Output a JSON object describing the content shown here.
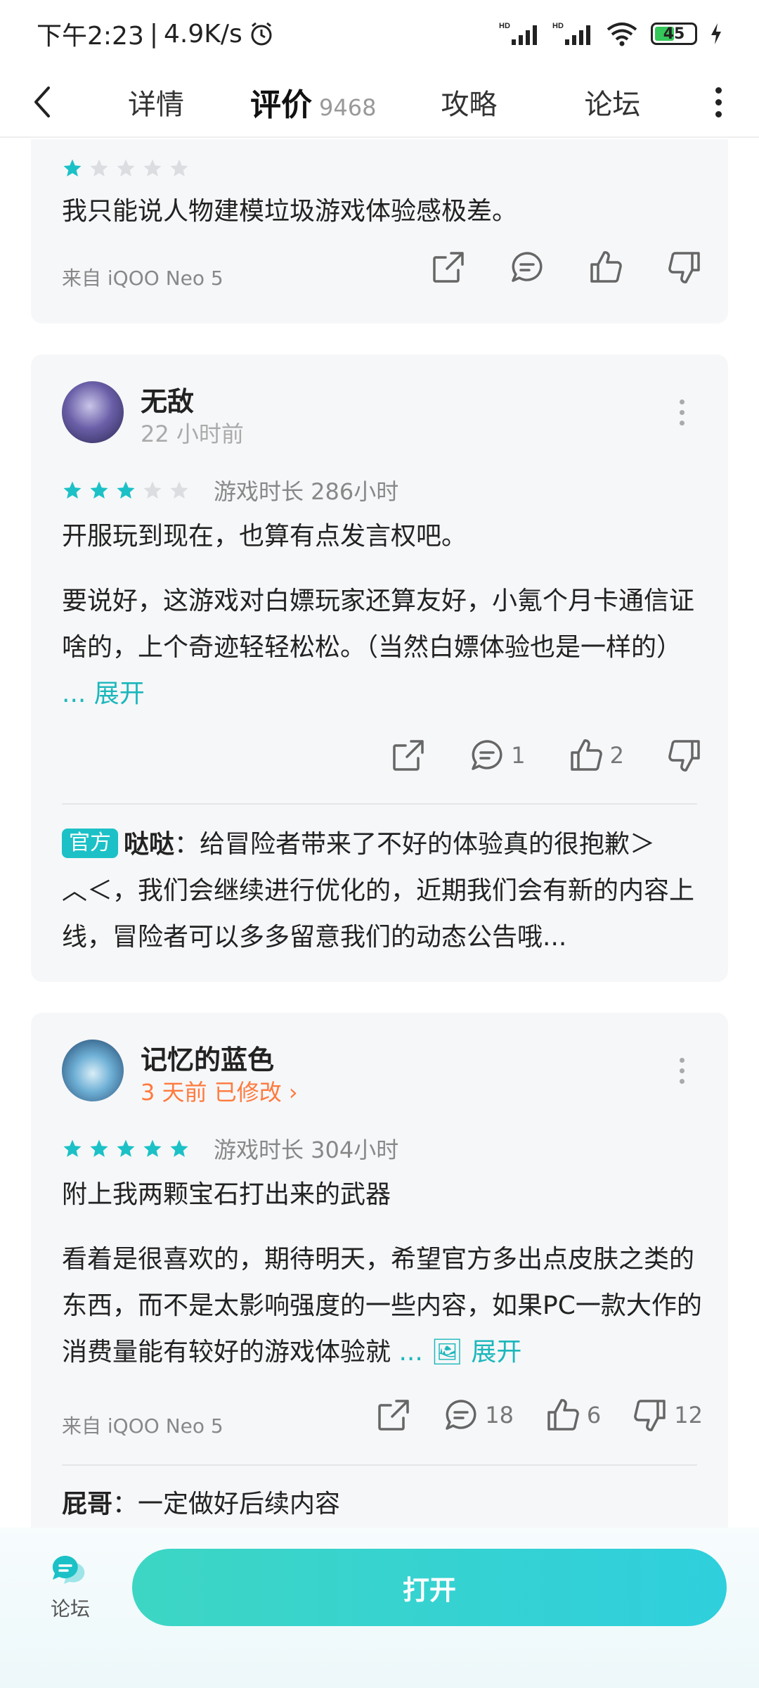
{
  "status_bar": {
    "time": "下午2:23",
    "net_speed": "4.9K/s",
    "battery": "45"
  },
  "nav": {
    "tabs": [
      {
        "label": "详情"
      },
      {
        "label": "评价",
        "count": "9468"
      },
      {
        "label": "攻略"
      },
      {
        "label": "论坛"
      }
    ]
  },
  "reviews": [
    {
      "rating": 1,
      "text": "我只能说人物建模垃圾游戏体验感极差。",
      "device": "来自 iQOO Neo 5"
    },
    {
      "username": "无敌",
      "time": "22 小时前",
      "rating": 3,
      "playtime": "游戏时长 286小时",
      "headline": "开服玩到现在，也算有点发言权吧。",
      "body": "要说好，这游戏对白嫖玩家还算友好，小氪个月卡通信证啥的，上个奇迹轻轻松松。（当然白嫖体验也是一样的）",
      "expand": "... 展开",
      "comments": "1",
      "likes": "2",
      "reply": {
        "badge": "官方",
        "author": "哒哒",
        "text": "：给冒险者带来了不好的体验真的很抱歉＞︿＜，我们会继续进行优化的，近期我们会有新的内容上线，冒险者可以多多留意我们的动态公告哦..."
      }
    },
    {
      "username": "记忆的蓝色",
      "time": "3 天前 已修改 ›",
      "rating": 5,
      "playtime": "游戏时长 304小时",
      "headline": "附上我两颗宝石打出来的武器",
      "body": "看着是很喜欢的，期待明天，希望官方多出点皮肤之类的东西，而不是太影响强度的一些内容，如果PC一款大作的消费量能有较好的游戏体验就",
      "expand": "... 🖼 展开",
      "device": "来自 iQOO Neo 5",
      "comments": "18",
      "likes": "6",
      "dislikes": "12",
      "reply": {
        "author": "屁哥",
        "text": "：一定做好后续内容"
      }
    }
  ],
  "bottom": {
    "forum_label": "论坛",
    "open_label": "打开"
  },
  "colors": {
    "accent": "#1bc1c6",
    "orange": "#ff7a3d"
  }
}
